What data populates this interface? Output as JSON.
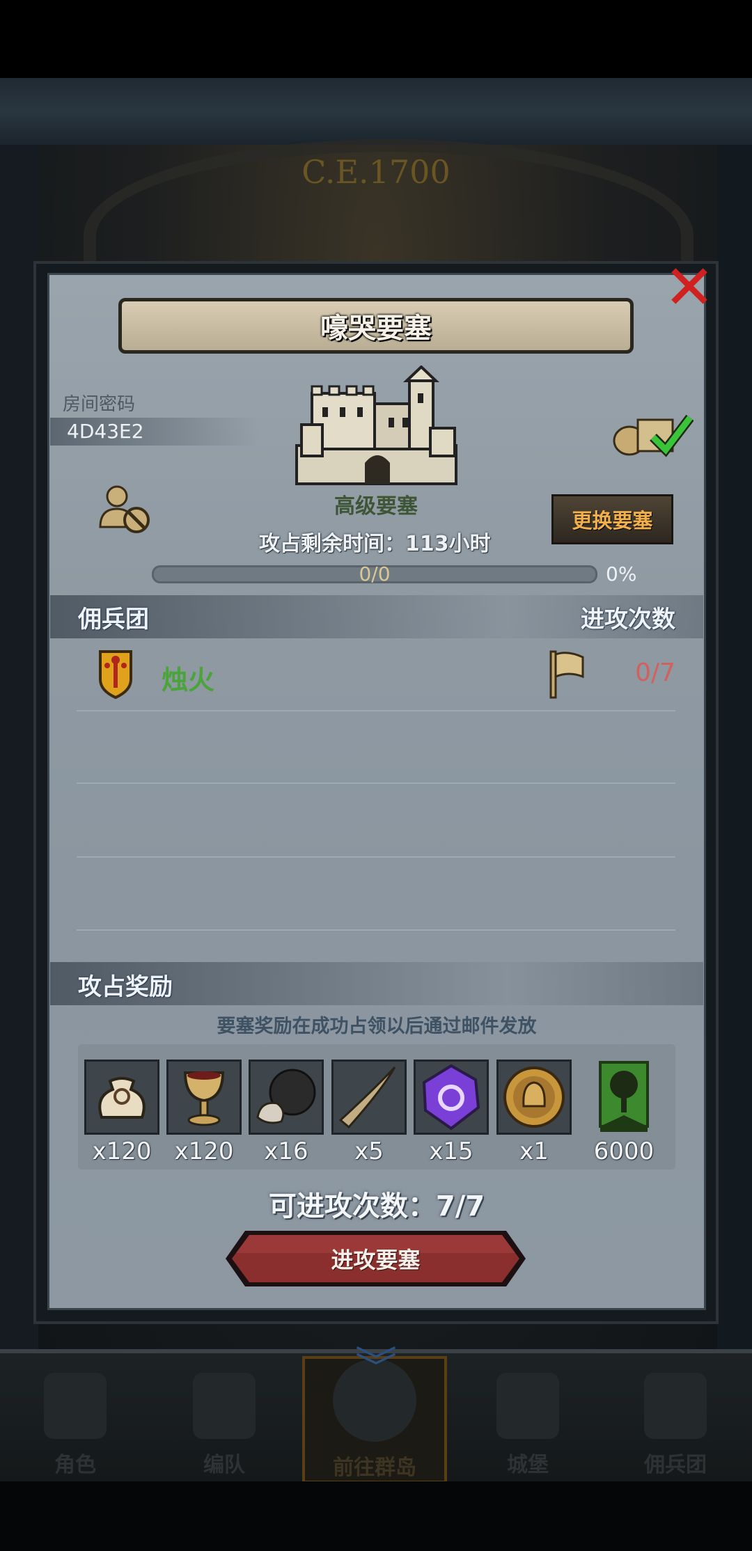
{
  "background": {
    "era_title": "C.E.1700"
  },
  "modal": {
    "title": "嚎哭要塞",
    "room_code_label": "房间密码",
    "room_code": "4D43E2",
    "fortress_type": "高级要塞",
    "change_button": "更换要塞",
    "time_label": "攻占剩余时间：113小时",
    "progress_text": "0/0",
    "progress_percent": "0%",
    "progress_fraction": 0,
    "guild_section": {
      "left_label": "佣兵团",
      "right_label": "进攻次数",
      "rows": [
        {
          "name": "烛火",
          "attacks": "0/7"
        }
      ]
    },
    "reward_section": {
      "label": "攻占奖励",
      "note": "要塞奖励在成功占领以后通过邮件发放",
      "items": [
        {
          "icon": "sack-icon",
          "qty": "x120"
        },
        {
          "icon": "goblet-icon",
          "qty": "x120"
        },
        {
          "icon": "truffle-icon",
          "qty": "x16"
        },
        {
          "icon": "horn-icon",
          "qty": "x5"
        },
        {
          "icon": "purple-crystal-icon",
          "qty": "x15"
        },
        {
          "icon": "knight-medal-icon",
          "qty": "x1"
        },
        {
          "icon": "tree-banner-icon",
          "qty": "6000"
        }
      ]
    },
    "attack_count": "可进攻次数：7/7",
    "attack_button": "进攻要塞"
  },
  "bottom_nav": [
    {
      "label": "角色",
      "icon": "knight-icon"
    },
    {
      "label": "编队",
      "icon": "helmet-icon"
    },
    {
      "label": "前往群岛",
      "icon": "island-icon",
      "active": true
    },
    {
      "label": "城堡",
      "icon": "castle-icon"
    },
    {
      "label": "佣兵团",
      "icon": "fist-icon"
    }
  ],
  "colors": {
    "close": "#d02020",
    "guild_name": "#4aa43a",
    "attacks_value": "#d2605e",
    "change_button_text": "#f1b04a",
    "attack_button": "#8a2e2e"
  }
}
